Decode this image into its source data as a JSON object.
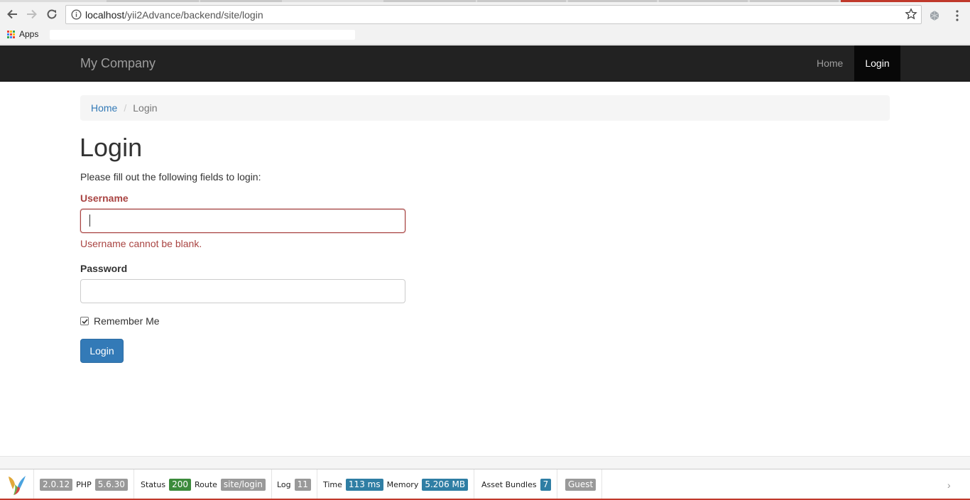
{
  "browser": {
    "url_host": "localhost",
    "url_path": "/yii2Advance/backend/site/login",
    "bookmarks": {
      "apps_label": "Apps"
    }
  },
  "navbar": {
    "brand": "My Company",
    "items": [
      {
        "label": "Home",
        "active": false
      },
      {
        "label": "Login",
        "active": true
      }
    ]
  },
  "breadcrumb": {
    "home": "Home",
    "separator": "/",
    "current": "Login"
  },
  "page": {
    "title": "Login",
    "intro": "Please fill out the following fields to login:"
  },
  "form": {
    "username": {
      "label": "Username",
      "value": "",
      "error": "Username cannot be blank."
    },
    "password": {
      "label": "Password",
      "value": ""
    },
    "remember": {
      "label": "Remember Me",
      "checked": true
    },
    "submit_label": "Login"
  },
  "debug_toolbar": {
    "yii_version": "2.0.12",
    "php_label": "PHP",
    "php_version": "5.6.30",
    "status_label": "Status",
    "status_code": "200",
    "route_label": "Route",
    "route": "site/login",
    "log_label": "Log",
    "log_count": "11",
    "time_label": "Time",
    "time_value": "113 ms",
    "memory_label": "Memory",
    "memory_value": "5.206 MB",
    "assets_label": "Asset Bundles",
    "assets_count": "7",
    "user": "Guest"
  },
  "colors": {
    "navbar_bg": "#222222",
    "link": "#337ab7",
    "error": "#a94442",
    "primary_button": "#337ab7",
    "status_ok": "#3c8b3c"
  }
}
